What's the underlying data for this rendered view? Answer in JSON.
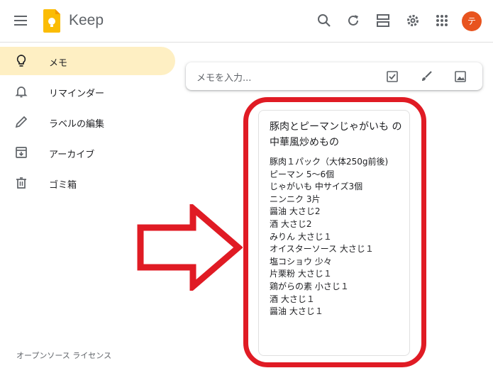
{
  "header": {
    "app_title": "Keep",
    "avatar_initial": "テ",
    "icons": [
      "menu-icon",
      "keep-logo-icon",
      "search-icon",
      "refresh-icon",
      "list-view-icon",
      "settings-icon",
      "apps-grid-icon"
    ]
  },
  "sidebar": {
    "items": [
      {
        "label": "メモ",
        "icon": "lightbulb-icon",
        "active": true
      },
      {
        "label": "リマインダー",
        "icon": "bell-icon"
      },
      {
        "label": "ラベルの編集",
        "icon": "pencil-icon"
      },
      {
        "label": "アーカイブ",
        "icon": "archive-icon"
      },
      {
        "label": "ゴミ箱",
        "icon": "trash-icon"
      }
    ],
    "footer_link": "オープンソース ライセンス"
  },
  "note_input": {
    "placeholder": "メモを入力...",
    "icons": [
      "checkbox-icon",
      "brush-icon",
      "image-icon"
    ]
  },
  "note": {
    "title": "豚肉とピーマンじゃがいも の中華風炒めもの",
    "lines": [
      "豚肉１パック（大体250g前後)",
      "ピーマン 5～6個",
      "じゃがいも 中サイズ3個",
      "ニンニク 3片",
      "醤油 大さじ2",
      "酒 大さじ2",
      "みりん 大さじ１",
      "オイスターソース 大さじ１",
      "塩コショウ 少々",
      "片栗粉 大さじ１",
      "鶏がらの素 小さじ１",
      "酒 大さじ１",
      "醤油 大さじ１"
    ]
  },
  "annotation_color": "#e01b24",
  "accent_color": "#feefc3"
}
